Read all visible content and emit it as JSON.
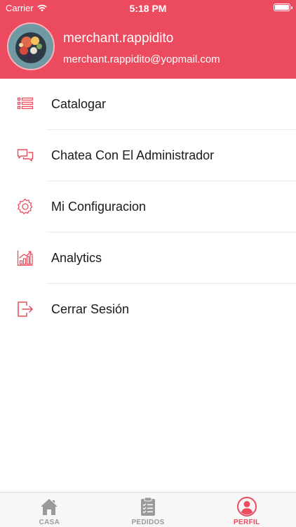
{
  "status_bar": {
    "carrier": "Carrier",
    "time": "5:18 PM"
  },
  "profile": {
    "username": "merchant.rappidito",
    "email": "merchant.rappidito@yopmail.com"
  },
  "menu": [
    {
      "label": "Catalogar",
      "icon": "list-icon"
    },
    {
      "label": "Chatea Con El Administrador",
      "icon": "chat-icon"
    },
    {
      "label": "Mi Configuracion",
      "icon": "gear-icon"
    },
    {
      "label": "Analytics",
      "icon": "chart-icon"
    },
    {
      "label": "Cerrar Sesión",
      "icon": "logout-icon"
    }
  ],
  "tabbar": [
    {
      "label": "CASA",
      "icon": "home-icon",
      "active": false
    },
    {
      "label": "PEDIDOS",
      "icon": "clipboard-icon",
      "active": false
    },
    {
      "label": "PERFIL",
      "icon": "user-icon",
      "active": true
    }
  ],
  "colors": {
    "accent": "#ec4a5f",
    "inactive": "#9a9a9a"
  }
}
